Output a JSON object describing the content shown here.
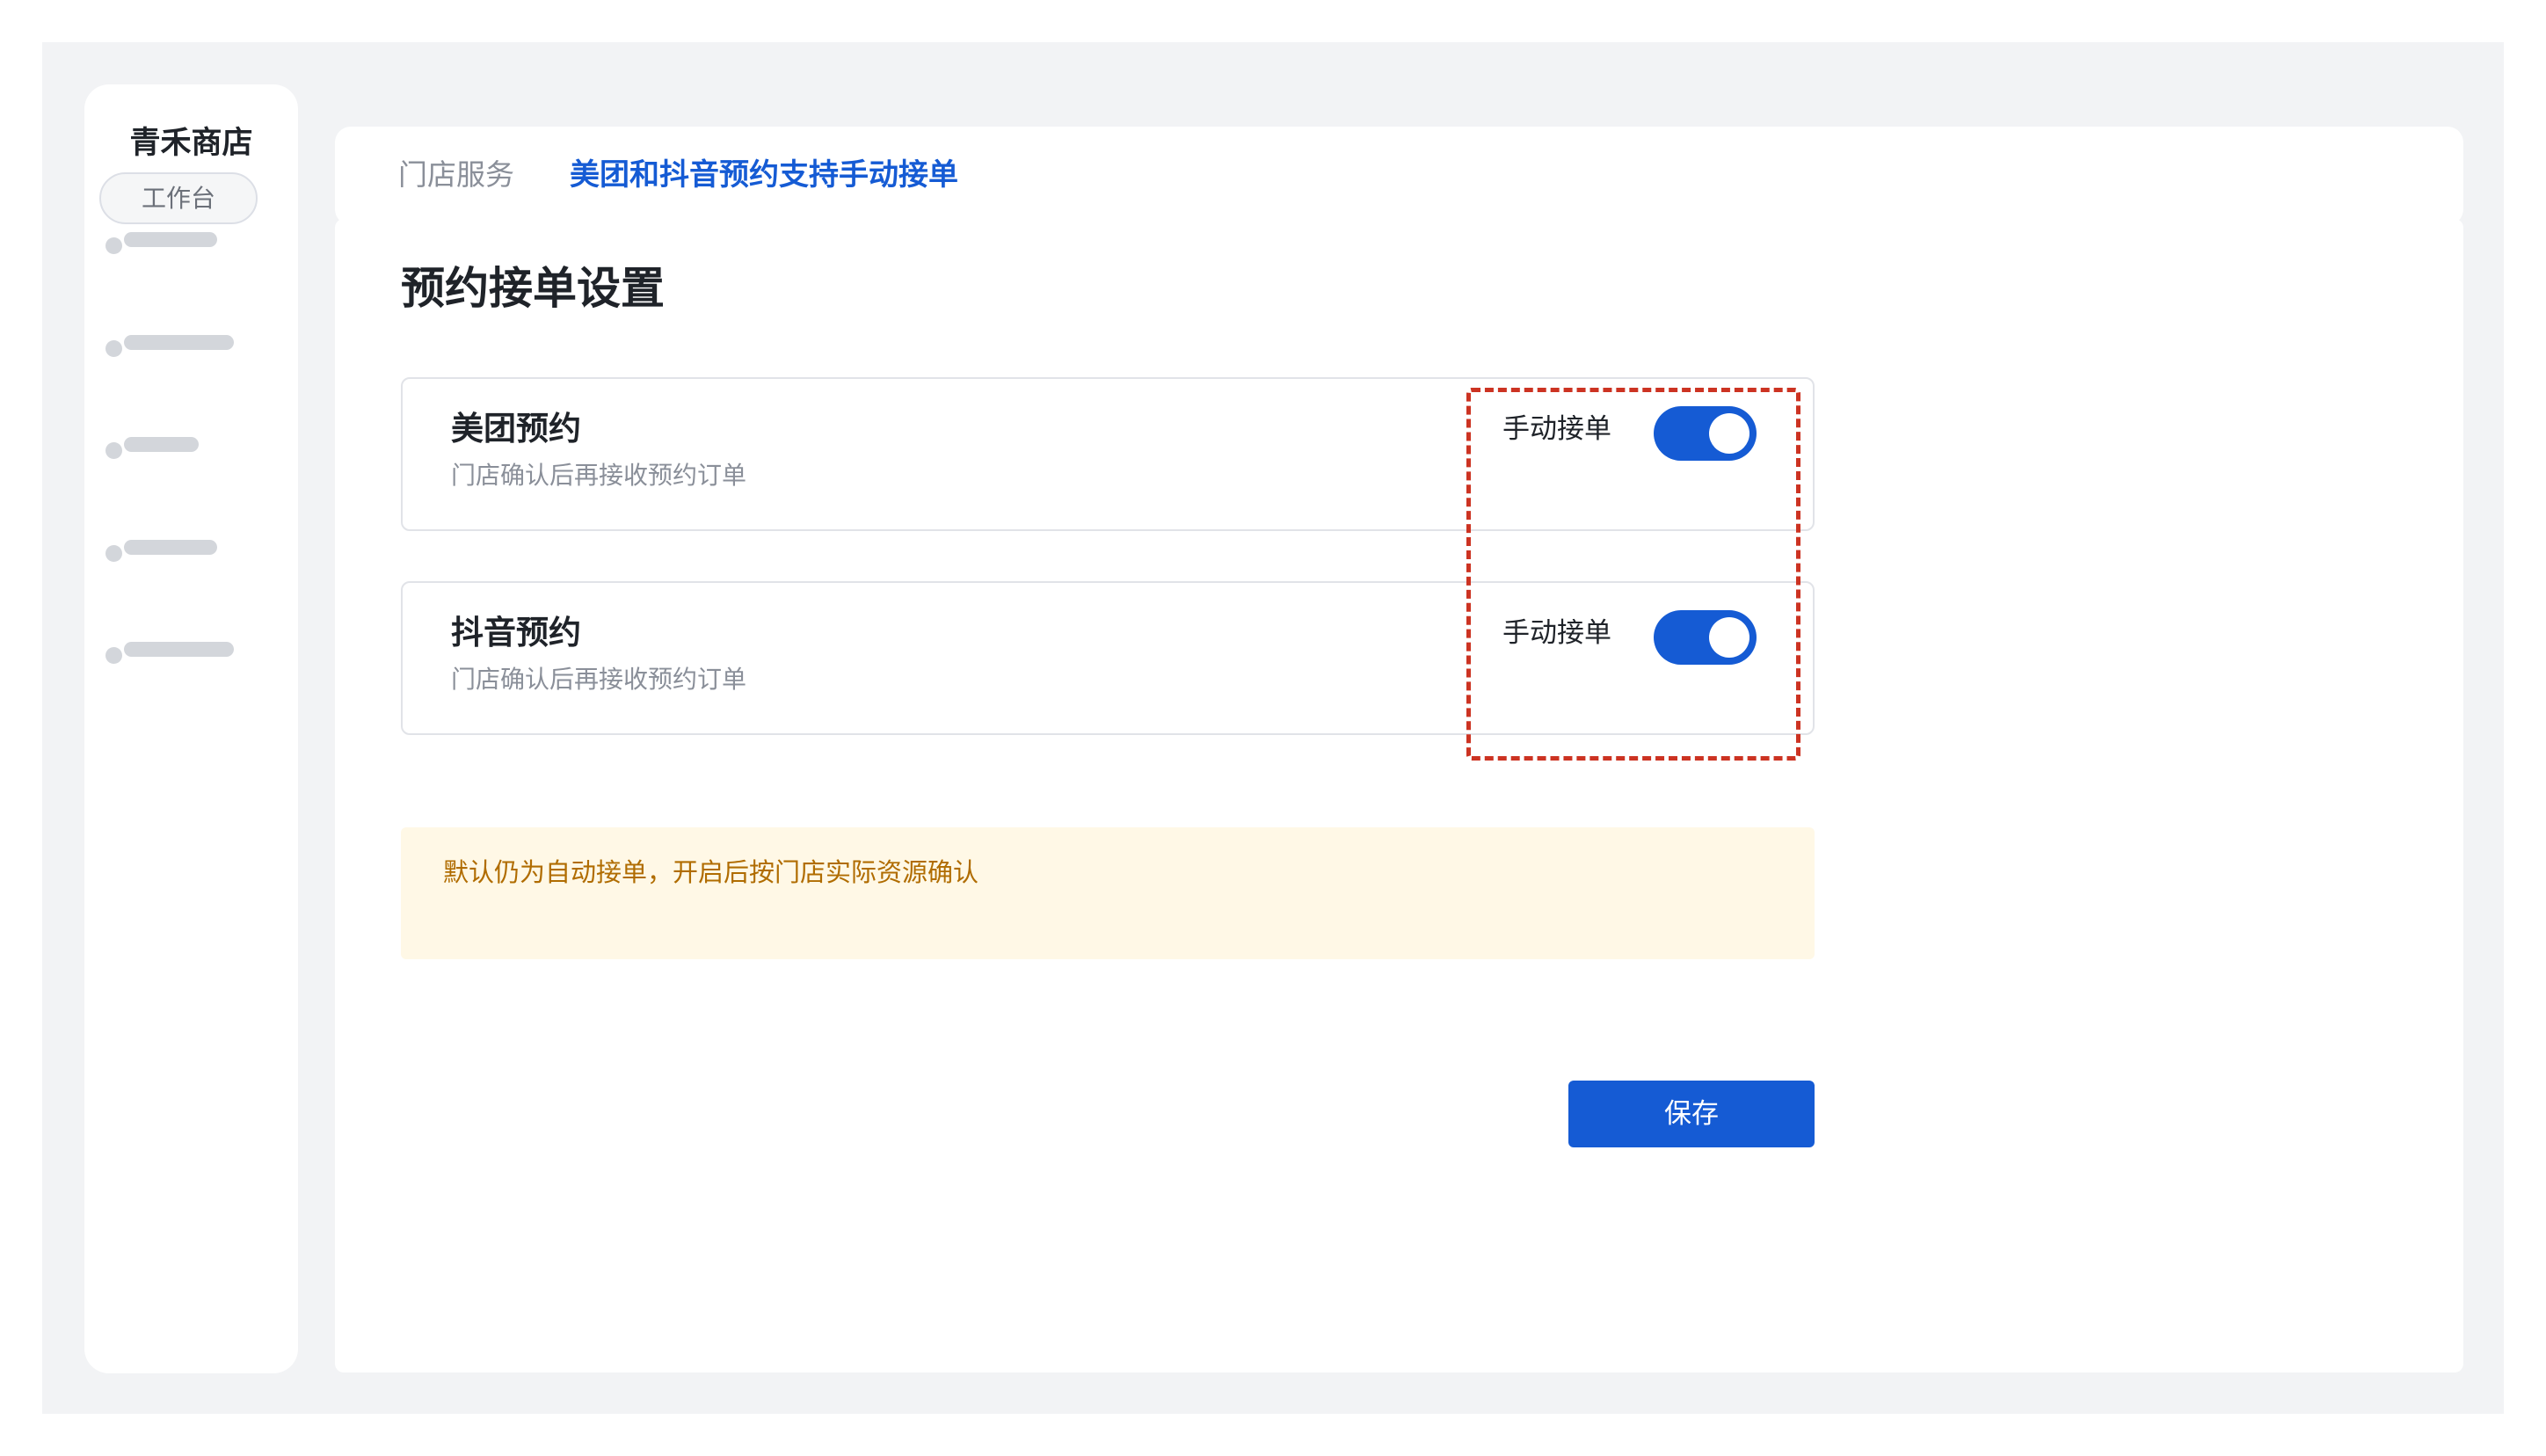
{
  "app": {
    "title": "青禾商店"
  },
  "sidebar": {
    "workbench_label": "工作台",
    "items": [
      {
        "label": ""
      },
      {
        "label": ""
      },
      {
        "label": ""
      },
      {
        "label": ""
      },
      {
        "label": ""
      }
    ]
  },
  "breadcrumb": {
    "items": [
      "门店服务",
      "美团和抖音预约支持手动接单"
    ]
  },
  "page": {
    "title": "预约接单设置"
  },
  "cards": [
    {
      "title": "美团预约",
      "description": "门店确认后再接收预约订单",
      "switch_label": "手动接单",
      "switch_on": true
    },
    {
      "title": "抖音预约",
      "description": "门店确认后再接收预约订单",
      "switch_label": "手动接单",
      "switch_on": true
    }
  ],
  "notice": {
    "text": "默认仍为自动接单，开启后按门店实际资源确认"
  },
  "actions": {
    "save_label": "保存"
  },
  "colors": {
    "accent": "#155bd4",
    "highlight_border": "#cc3322",
    "notice_bg": "#fff8e6",
    "notice_text": "#b06c00"
  }
}
